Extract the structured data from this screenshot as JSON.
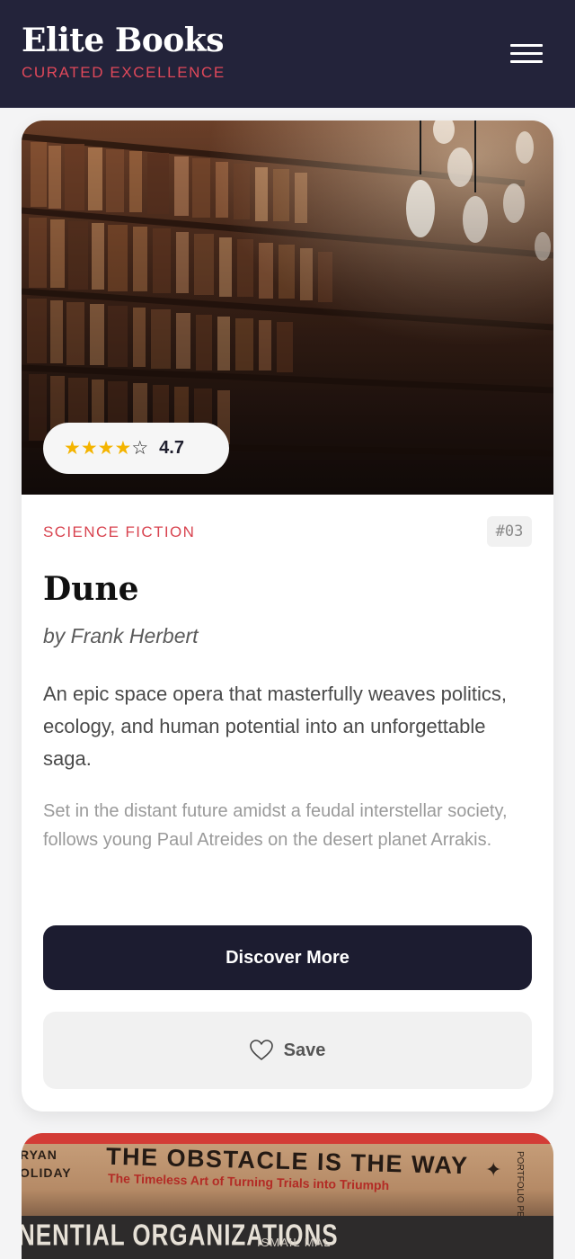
{
  "header": {
    "title": "Elite Books",
    "subtitle": "CURATED EXCELLENCE",
    "menu_icon": "hamburger-menu-icon"
  },
  "book": {
    "rating_stars_filled": 4,
    "rating_stars_total": 5,
    "rating": "4.7",
    "genre": "SCIENCE FICTION",
    "rank": "#03",
    "title": "Dune",
    "author": "by Frank Herbert",
    "description": "An epic space opera that masterfully weaves politics, ecology, and human potential into an unforgettable saga.",
    "synopsis": "Set in the distant future amidst a feudal interstellar society, follows young Paul Atreides on the desert planet Arrakis.",
    "primary_action": "Discover More",
    "save_action": "Save",
    "save_icon": "heart-icon"
  },
  "next_book_cover": {
    "author": "RYAN\nOLIDAY",
    "title": "THE OBSTACLE IS THE WAY",
    "subtitle": "The Timeless Art of Turning Trials into Triumph",
    "spine_text": "NENTIAL ORGANIZATIONS",
    "spine_text_2": "ISMAIL  MAL",
    "side_text": "PORTFOLIO PENGUIN"
  },
  "colors": {
    "header_bg": "#23233a",
    "accent": "#e0485a",
    "primary_button": "#1c1c30",
    "page_bg": "#f4f4f5"
  }
}
